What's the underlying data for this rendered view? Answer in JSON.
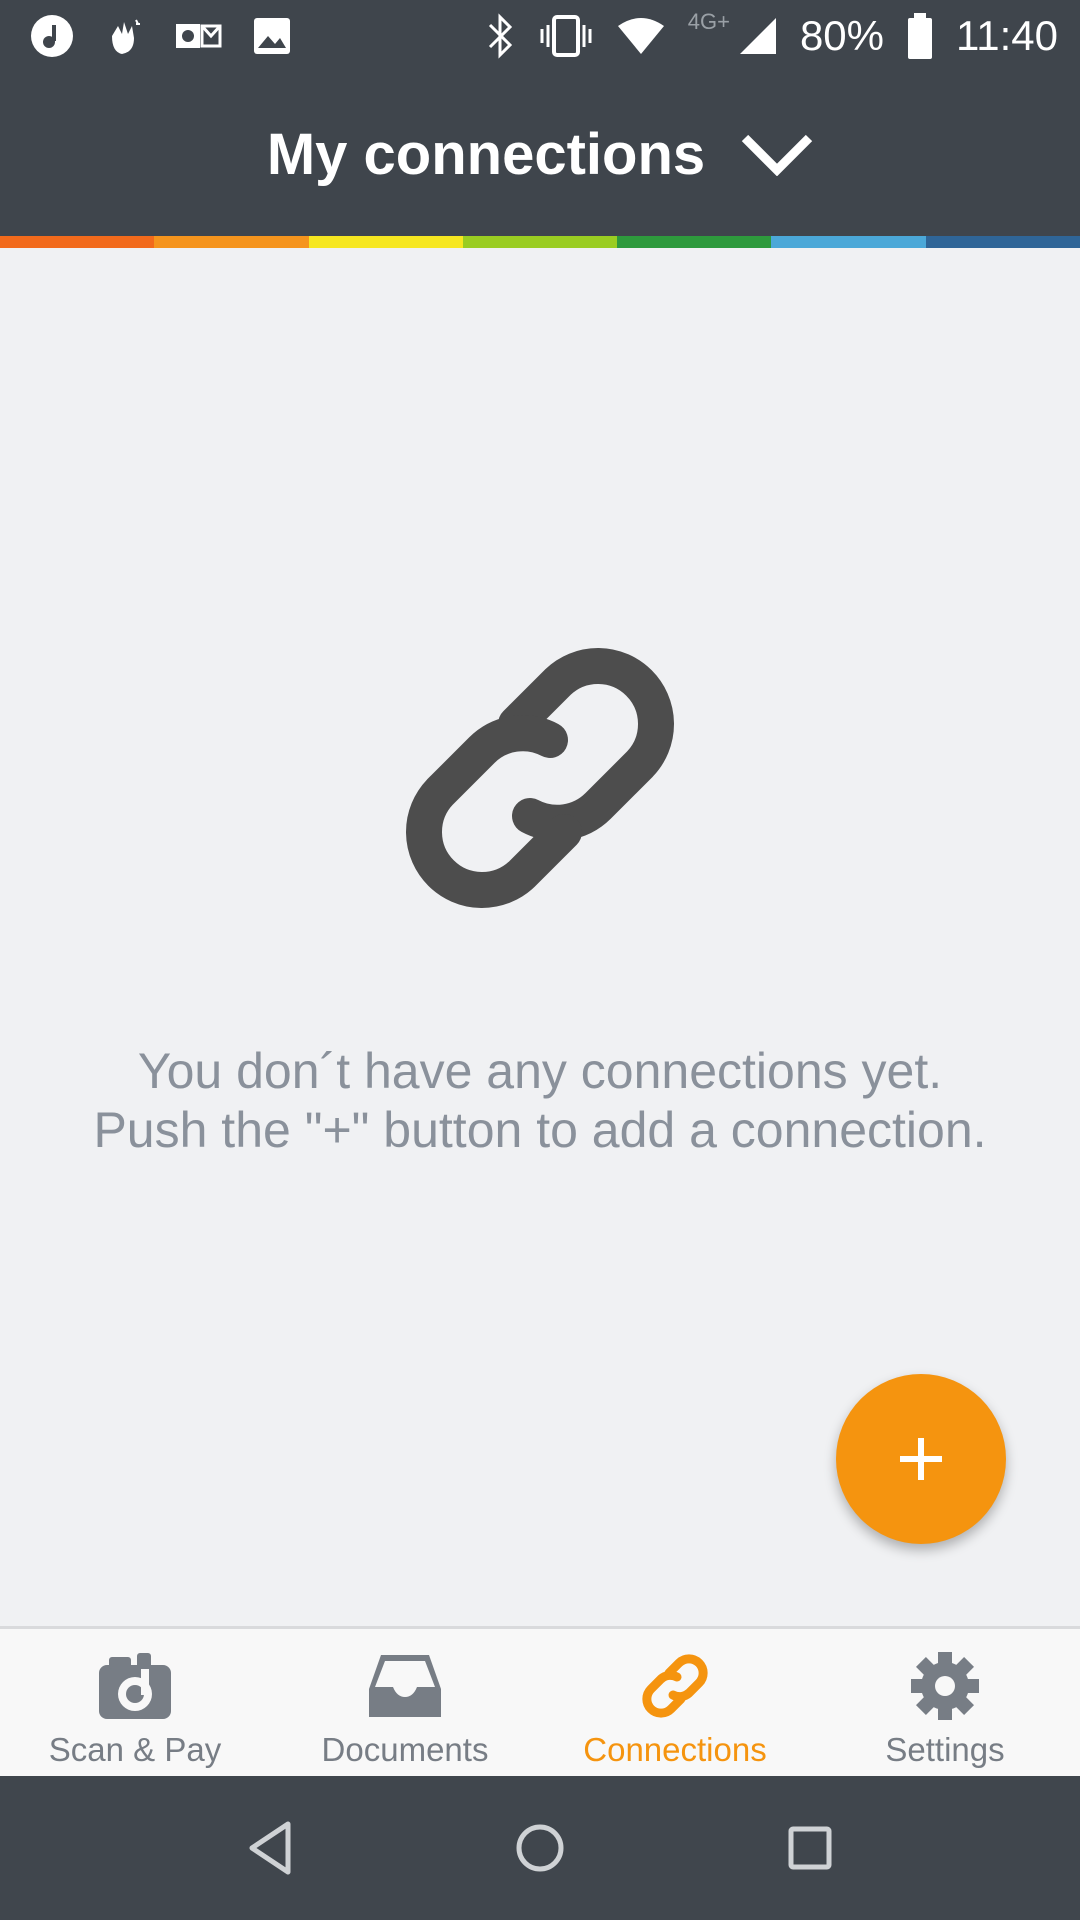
{
  "status_bar": {
    "network": "4G+",
    "battery": "80%",
    "time": "11:40"
  },
  "header": {
    "title": "My connections"
  },
  "rainbow_colors": [
    "#f26a1b",
    "#f5941d",
    "#f6e721",
    "#9acd22",
    "#2e9a3d",
    "#4ba8d8",
    "#2f6597"
  ],
  "empty_state": {
    "line1": "You don´t have any connections yet.",
    "line2": "Push the \"+\" button to add a connection."
  },
  "fab": {
    "color": "#f5940f",
    "icon": "plus-icon"
  },
  "bottom_nav": {
    "items": [
      {
        "label": "Scan & Pay",
        "icon": "camera-icon",
        "active": false
      },
      {
        "label": "Documents",
        "icon": "inbox-icon",
        "active": false
      },
      {
        "label": "Connections",
        "icon": "link-icon",
        "active": true
      },
      {
        "label": "Settings",
        "icon": "gear-icon",
        "active": false
      }
    ],
    "active_color": "#f5940f",
    "inactive_color": "#777d85"
  }
}
